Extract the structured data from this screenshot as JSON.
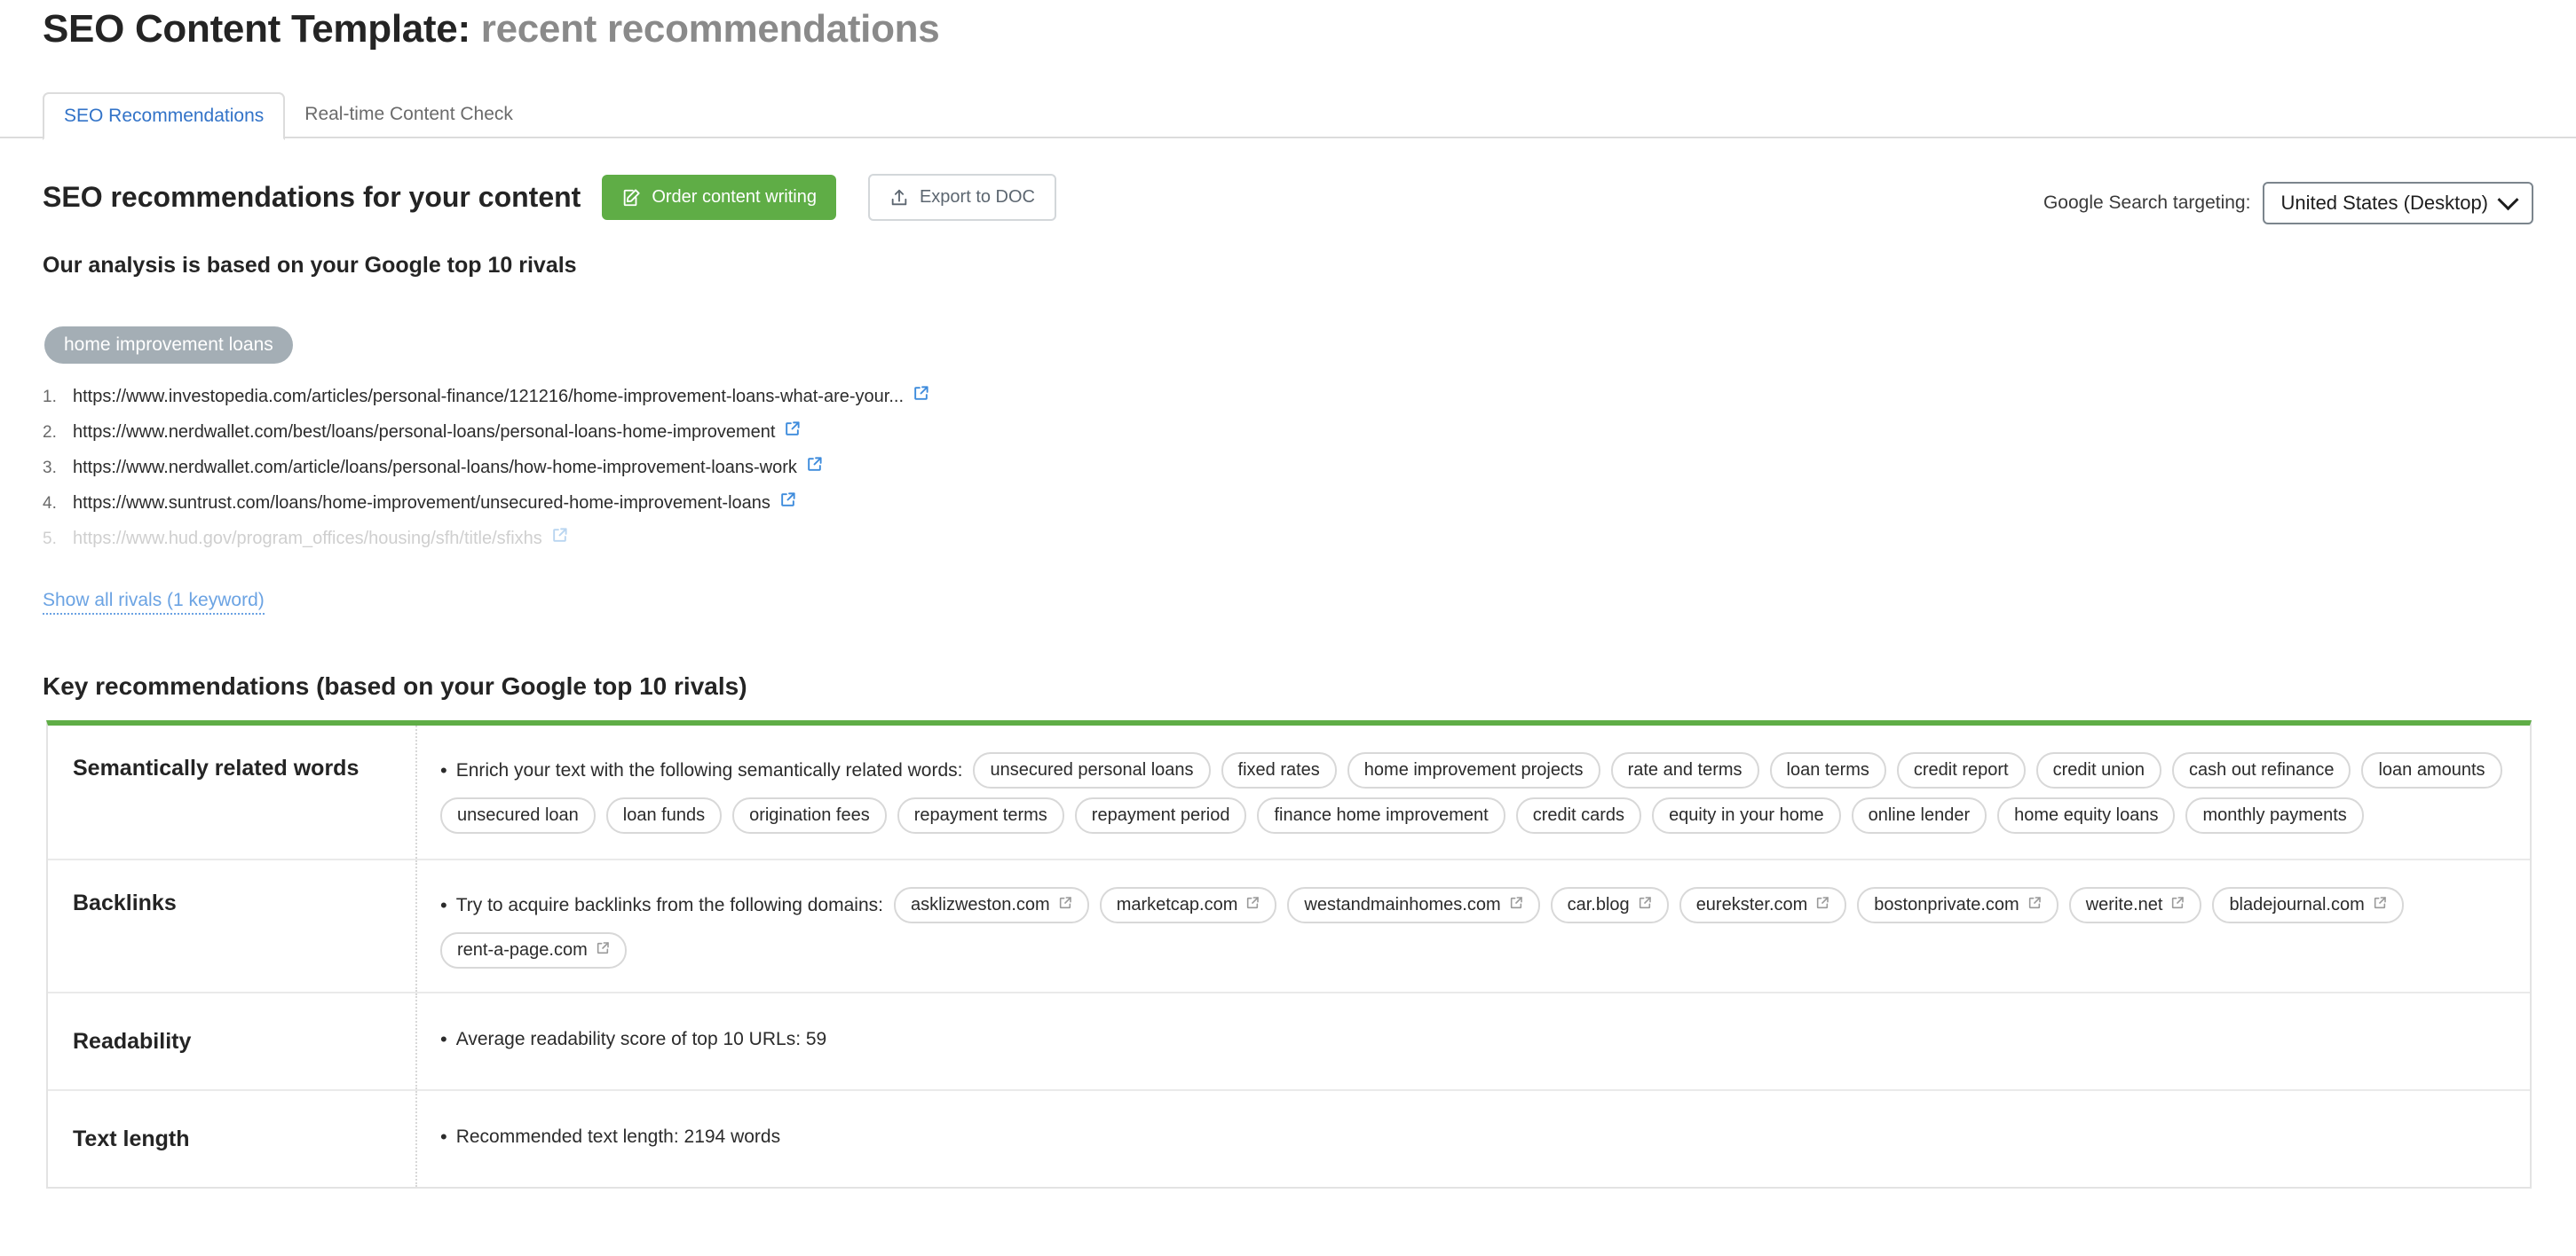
{
  "header": {
    "title_strong": "SEO Content Template:",
    "title_muted": "recent recommendations"
  },
  "tabs": [
    {
      "label": "SEO Recommendations",
      "active": true
    },
    {
      "label": "Real-time Content Check",
      "active": false
    }
  ],
  "toolbar": {
    "section_title": "SEO recommendations for your content",
    "order_button": "Order content writing",
    "export_button": "Export to DOC",
    "targeting_label": "Google Search targeting:",
    "targeting_value": "United States (Desktop)"
  },
  "analysis": {
    "title": "Our analysis is based on your Google top 10 rivals",
    "keyword": "home improvement loans",
    "rivals": [
      {
        "num": "1.",
        "url": "https://www.investopedia.com/articles/personal-finance/121216/home-improvement-loans-what-are-your...",
        "dim": false
      },
      {
        "num": "2.",
        "url": "https://www.nerdwallet.com/best/loans/personal-loans/personal-loans-home-improvement",
        "dim": false
      },
      {
        "num": "3.",
        "url": "https://www.nerdwallet.com/article/loans/personal-loans/how-home-improvement-loans-work",
        "dim": false
      },
      {
        "num": "4.",
        "url": "https://www.suntrust.com/loans/home-improvement/unsecured-home-improvement-loans",
        "dim": false
      },
      {
        "num": "5.",
        "url": "https://www.hud.gov/program_offices/housing/sfh/title/sfixhs",
        "dim": true
      }
    ],
    "show_all": "Show all rivals (1 keyword)"
  },
  "key_recommendations": {
    "title": "Key recommendations (based on your Google top 10 rivals)",
    "rows": [
      {
        "label": "Semantically related words",
        "lead": "Enrich your text with the following semantically related words:",
        "pills": [
          "unsecured personal loans",
          "fixed rates",
          "home improvement projects",
          "rate and terms",
          "loan terms",
          "credit report",
          "credit union",
          "cash out refinance",
          "loan amounts",
          "unsecured loan",
          "loan funds",
          "origination fees",
          "repayment terms",
          "repayment period",
          "finance home improvement",
          "credit cards",
          "equity in your home",
          "online lender",
          "home equity loans",
          "monthly payments"
        ]
      },
      {
        "label": "Backlinks",
        "lead": "Try to acquire backlinks from the following domains:",
        "pills": [
          "asklizweston.com",
          "marketcap.com",
          "westandmainhomes.com",
          "car.blog",
          "eurekster.com",
          "bostonprivate.com",
          "werite.net",
          "bladejournal.com",
          "rent-a-page.com"
        ]
      },
      {
        "label": "Readability",
        "lead": "Average readability score of top 10 URLs:  59",
        "pills": []
      },
      {
        "label": "Text length",
        "lead": "Recommended text length:  2194 words",
        "pills": []
      }
    ]
  },
  "colors": {
    "accent_green": "#5fad46",
    "link_blue": "#3273c8",
    "external_icon_blue": "#3d8bdc",
    "keyword_chip": "#a4aeb5"
  },
  "icons": {
    "order": "pencil-document-icon",
    "export": "upload-icon",
    "external": "external-link-icon",
    "caret": "chevron-down-icon"
  }
}
